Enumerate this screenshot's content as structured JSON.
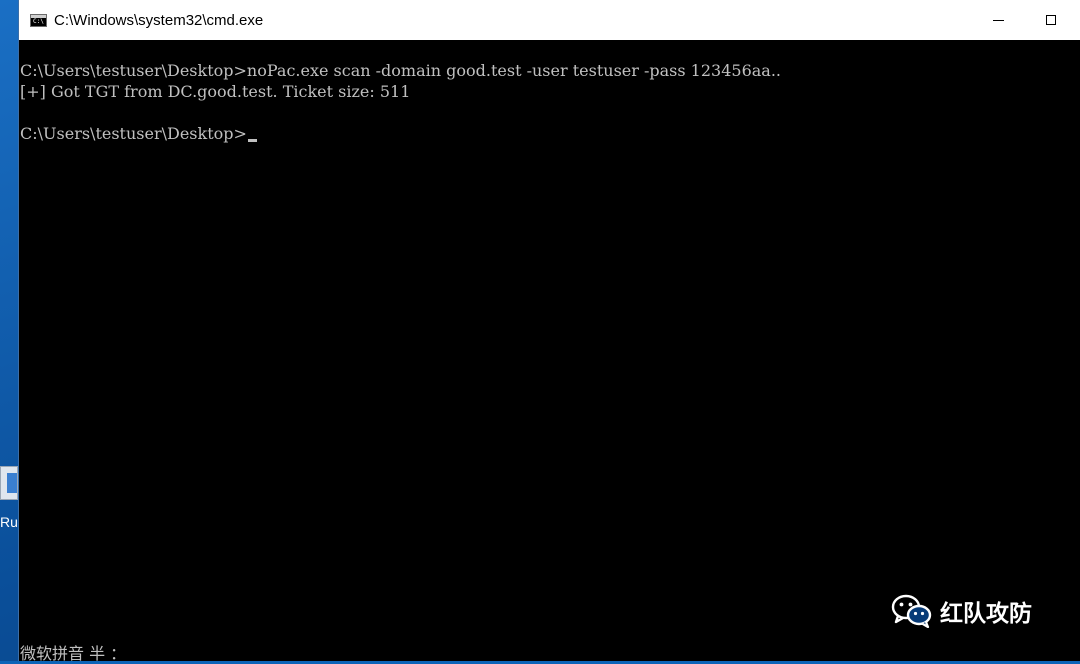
{
  "window": {
    "title": "C:\\Windows\\system32\\cmd.exe",
    "icon": "cmd-icon",
    "icon_text": "C:\\"
  },
  "console": {
    "lines": [
      "C:\\Users\\testuser\\Desktop>noPac.exe scan -domain good.test -user testuser -pass 123456aa..",
      "[+] Got TGT from DC.good.test. Ticket size: 511",
      "C:\\Users\\testuser\\Desktop>"
    ],
    "ime_status": "微软拼音 半 ："
  },
  "desktop": {
    "icon_label": "Rubeus"
  },
  "watermark": {
    "text": "红队攻防",
    "icon": "wechat-icon"
  },
  "colors": {
    "titlebar": "#ffffff",
    "console_bg": "#000000",
    "console_text": "#c0c0c0",
    "desktop": "#0c64b8"
  }
}
